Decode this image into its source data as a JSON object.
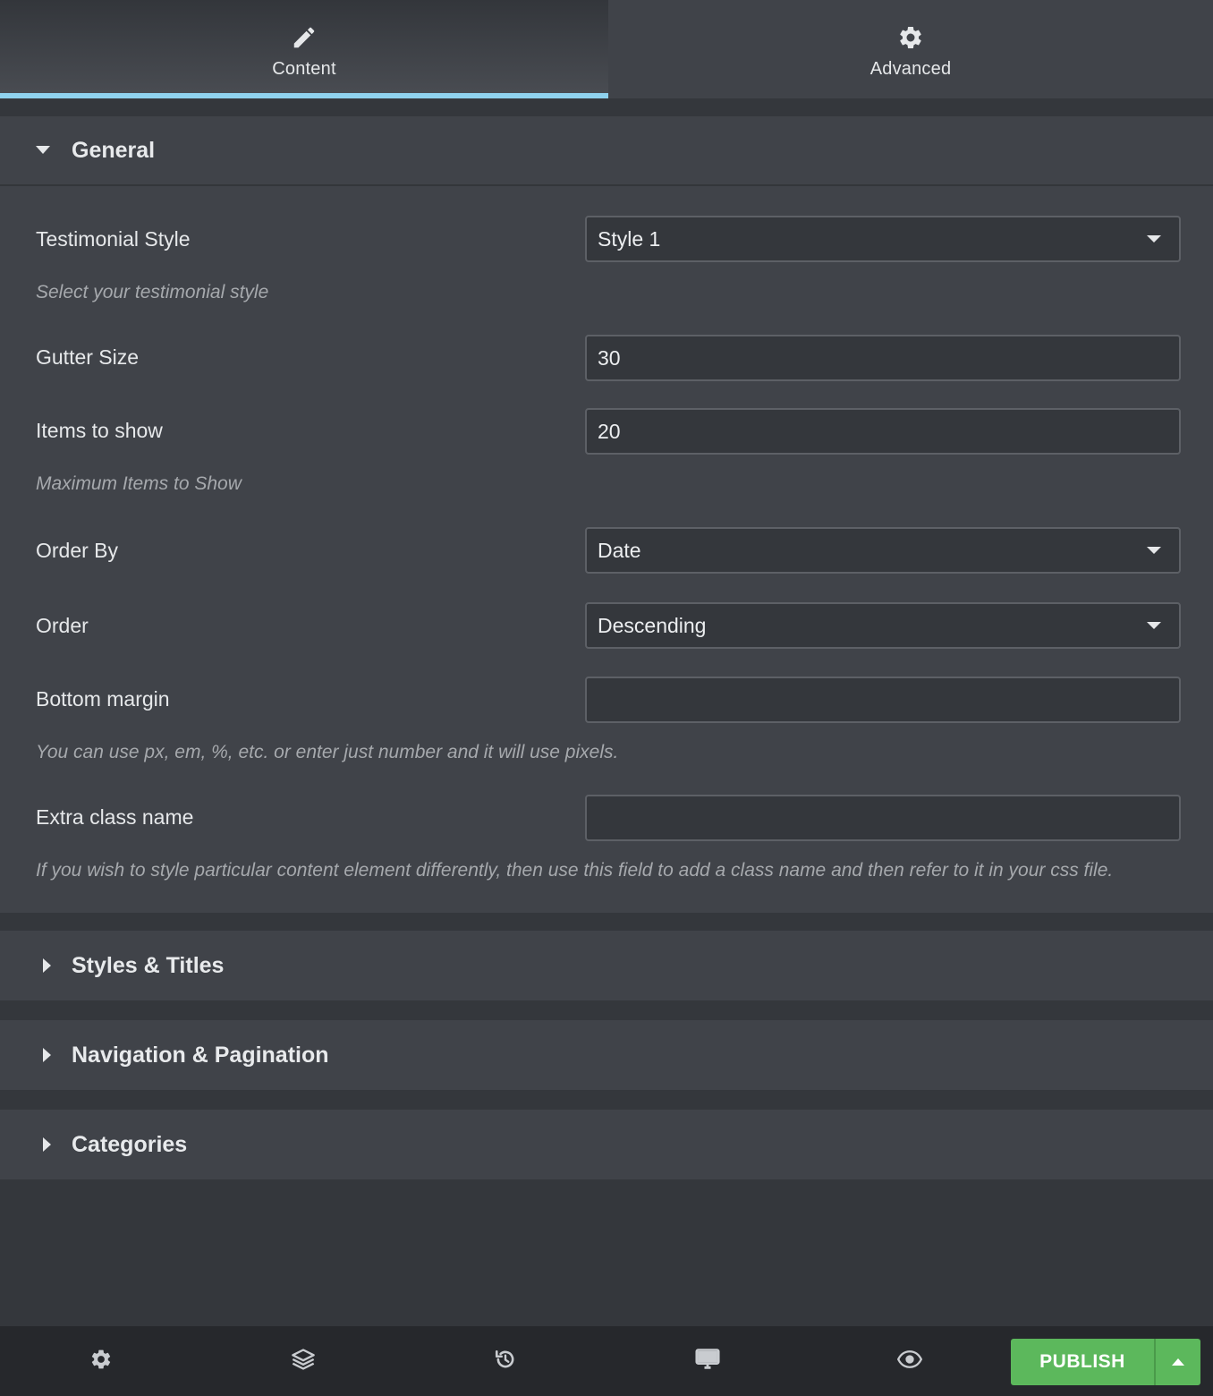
{
  "tabs": [
    {
      "label": "Content",
      "icon": "pencil-icon",
      "active": true
    },
    {
      "label": "Advanced",
      "icon": "gear-icon",
      "active": false
    }
  ],
  "general": {
    "title": "General",
    "testimonial_style": {
      "label": "Testimonial Style",
      "value": "Style 1",
      "hint": "Select your testimonial style"
    },
    "gutter_size": {
      "label": "Gutter Size",
      "value": "30"
    },
    "items_to_show": {
      "label": "Items to show",
      "value": "20",
      "hint": "Maximum Items to Show"
    },
    "order_by": {
      "label": "Order By",
      "value": "Date"
    },
    "order": {
      "label": "Order",
      "value": "Descending"
    },
    "bottom_margin": {
      "label": "Bottom margin",
      "value": "",
      "hint": "You can use px, em, %, etc. or enter just number and it will use pixels."
    },
    "extra_class": {
      "label": "Extra class name",
      "value": "",
      "hint": "If you wish to style particular content element differently, then use this field to add a class name and then refer to it in your css file."
    }
  },
  "sections": [
    {
      "title": "Styles & Titles"
    },
    {
      "title": "Navigation & Pagination"
    },
    {
      "title": "Categories"
    }
  ],
  "toolbar": {
    "publish_label": "PUBLISH",
    "icons": [
      "gear-icon",
      "layers-icon",
      "history-icon",
      "desktop-icon",
      "eye-icon",
      "caret-up-icon"
    ]
  },
  "colors": {
    "accent_tab": "#8fd2ee",
    "publish": "#5cb85c",
    "panel": "#404349",
    "background": "#34373c"
  }
}
